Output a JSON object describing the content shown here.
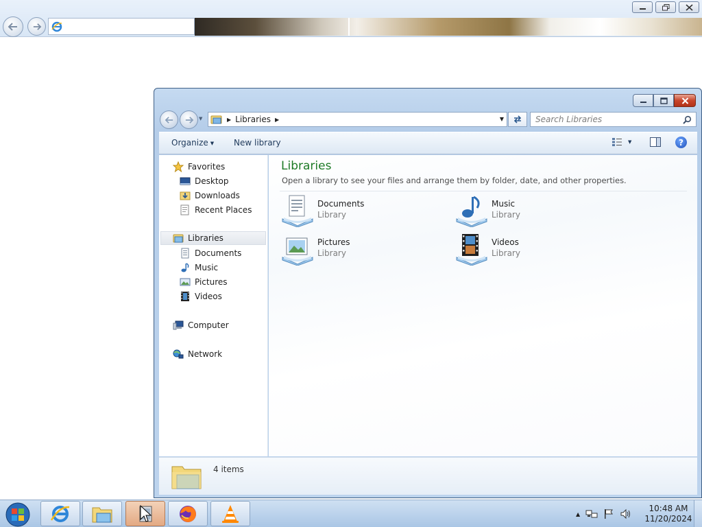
{
  "explorer": {
    "address": {
      "label": "Libraries"
    },
    "search": {
      "placeholder": "Search Libraries"
    },
    "toolbar": {
      "organize_label": "Organize",
      "new_library_label": "New library"
    },
    "nav": {
      "favorites": "Favorites",
      "desktop": "Desktop",
      "downloads": "Downloads",
      "recent_places": "Recent Places",
      "libraries": "Libraries",
      "documents": "Documents",
      "music": "Music",
      "pictures": "Pictures",
      "videos": "Videos",
      "computer": "Computer",
      "network": "Network"
    },
    "content": {
      "title": "Libraries",
      "description": "Open a library to see your files and arrange them by folder, date, and other properties.",
      "items": [
        {
          "name": "Documents",
          "type": "Library",
          "icon": "documents-library-icon"
        },
        {
          "name": "Music",
          "type": "Library",
          "icon": "music-library-icon"
        },
        {
          "name": "Pictures",
          "type": "Library",
          "icon": "pictures-library-icon"
        },
        {
          "name": "Videos",
          "type": "Library",
          "icon": "videos-library-icon"
        }
      ]
    },
    "details": {
      "item_count": "4 items"
    }
  },
  "taskbar": {
    "apps": [
      "internet-explorer-icon",
      "windows-explorer-icon",
      "application-icon",
      "firefox-icon",
      "vlc-icon"
    ],
    "clock": {
      "time": "10:48 AM",
      "date": "11/20/2024"
    }
  },
  "colors": {
    "title_green": "#1d7a25",
    "taskbar": "#bcd3ec",
    "close_button": "#c8452b"
  }
}
